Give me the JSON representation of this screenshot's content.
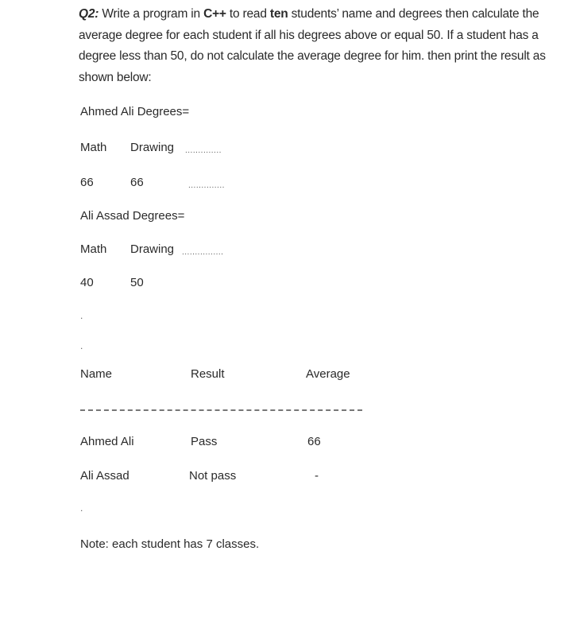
{
  "question": {
    "label": "Q2:",
    "text_1": " Write a program in ",
    "lang": "C++",
    "text_2": " to read ",
    "count_word": "ten",
    "text_3": " students’ name and degrees then calculate the average degree for each student if all his degrees above or equal 50. If a student has a degree less than 50, do not calculate the average degree for him. then print the result as shown below:"
  },
  "example_input": [
    {
      "header": "Ahmed Ali Degrees=",
      "subjects": [
        "Math",
        "Drawing"
      ],
      "subjects_trail": "..............",
      "degrees": [
        "66",
        "66"
      ],
      "degrees_trail": ".............."
    },
    {
      "header": "Ali Assad Degrees=",
      "subjects": [
        "Math",
        "Drawing"
      ],
      "subjects_trail": "................",
      "degrees": [
        "40",
        "50"
      ]
    }
  ],
  "ellipsis_bullets": [
    ".",
    "."
  ],
  "output_table": {
    "headers": [
      "Name",
      "Result",
      "Average"
    ],
    "separator": "-----",
    "rows": [
      {
        "name": "Ahmed Ali",
        "result": "Pass",
        "average": "66"
      },
      {
        "name": "Ali Assad",
        "result": "Not pass",
        "average": "-"
      }
    ],
    "trailing_bullet": "."
  },
  "note": "Note: each student has 7 classes."
}
